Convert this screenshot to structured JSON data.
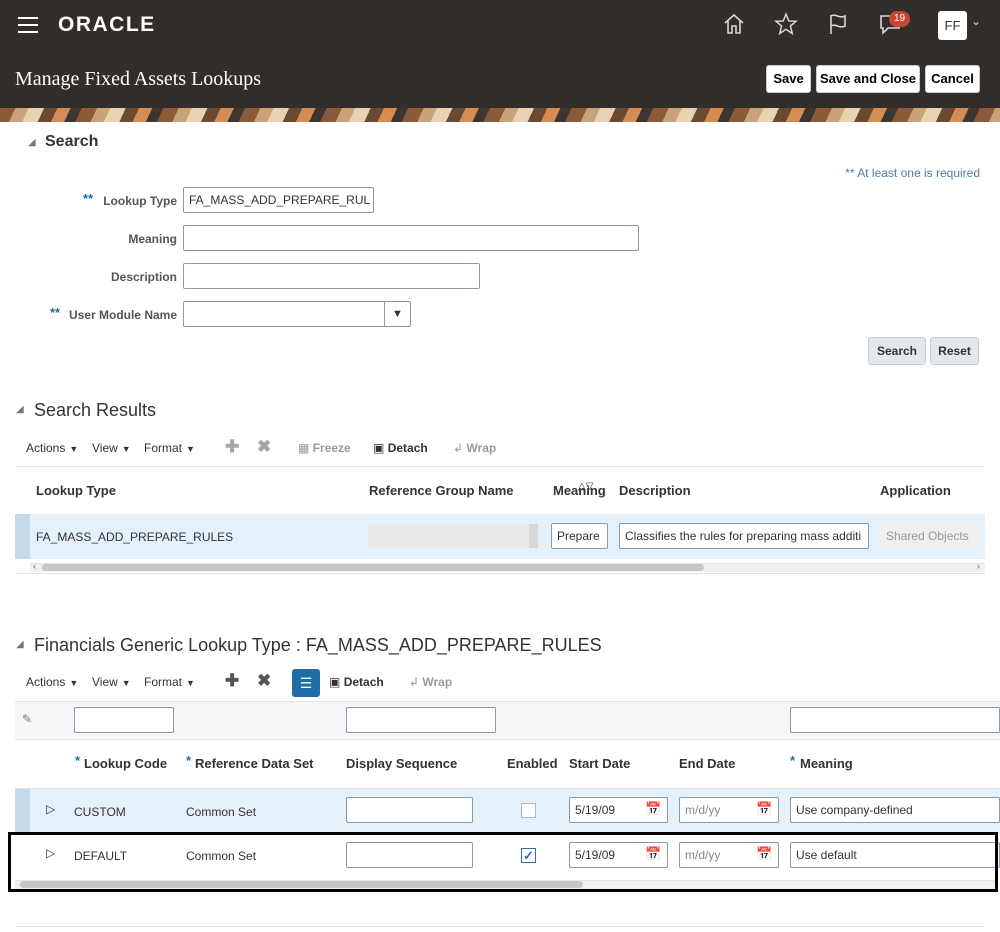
{
  "header": {
    "logo": "ORACLE",
    "notification_count": "19",
    "user_initials": "FF",
    "page_title": "Manage Fixed Assets Lookups",
    "buttons": {
      "save": "Save",
      "save_close": "Save and Close",
      "cancel": "Cancel"
    }
  },
  "search": {
    "title": "Search",
    "required_note": "** At least one is required",
    "required_marker": "**",
    "fields": {
      "lookup_type": {
        "label": "Lookup Type",
        "value": "FA_MASS_ADD_PREPARE_RUL"
      },
      "meaning": {
        "label": "Meaning",
        "value": ""
      },
      "description": {
        "label": "Description",
        "value": ""
      },
      "user_module": {
        "label": "User Module Name",
        "value": ""
      }
    },
    "search_button": "Search",
    "reset_button": "Reset"
  },
  "results": {
    "title": "Search Results",
    "toolbar": {
      "actions": "Actions",
      "view": "View",
      "format": "Format",
      "freeze": "Freeze",
      "detach": "Detach",
      "wrap": "Wrap"
    },
    "columns": {
      "lookup_type": "Lookup Type",
      "ref_group": "Reference Group Name",
      "meaning": "Meaning",
      "description": "Description",
      "application": "Application"
    },
    "row": {
      "lookup_type": "FA_MASS_ADD_PREPARE_RULES",
      "meaning": "Prepare",
      "description": "Classifies the rules for preparing mass additi",
      "application": "Shared Objects"
    }
  },
  "lookup_codes": {
    "title": "Financials Generic Lookup Type : FA_MASS_ADD_PREPARE_RULES",
    "toolbar": {
      "actions": "Actions",
      "view": "View",
      "format": "Format",
      "detach": "Detach",
      "wrap": "Wrap"
    },
    "required_marker": "*",
    "columns": {
      "lookup_code": "Lookup Code",
      "ref_data_set": "Reference Data Set",
      "display_seq": "Display Sequence",
      "enabled": "Enabled",
      "start_date": "Start Date",
      "end_date": "End Date",
      "meaning": "Meaning"
    },
    "date_placeholder": "m/d/yy",
    "rows": [
      {
        "code": "CUSTOM",
        "ref_set": "Common Set",
        "seq": "",
        "enabled": false,
        "start": "5/19/09",
        "end": "",
        "meaning": "Use company-defined"
      },
      {
        "code": "DEFAULT",
        "ref_set": "Common Set",
        "seq": "",
        "enabled": true,
        "start": "5/19/09",
        "end": "",
        "meaning": "Use default"
      }
    ]
  },
  "icons": [
    "menu-icon",
    "home-icon",
    "favorites-star-icon",
    "flag-icon",
    "notifications-icon",
    "add-icon",
    "delete-icon",
    "freeze-icon",
    "detach-icon",
    "wrap-icon",
    "query-by-example-icon",
    "calendar-icon",
    "expand-row-icon",
    "checkmark-icon"
  ],
  "colors": {
    "header_bg": "#312d2a",
    "selected_row": "#e4f0fa",
    "badge": "#c74634",
    "accent": "#1f6da4"
  }
}
